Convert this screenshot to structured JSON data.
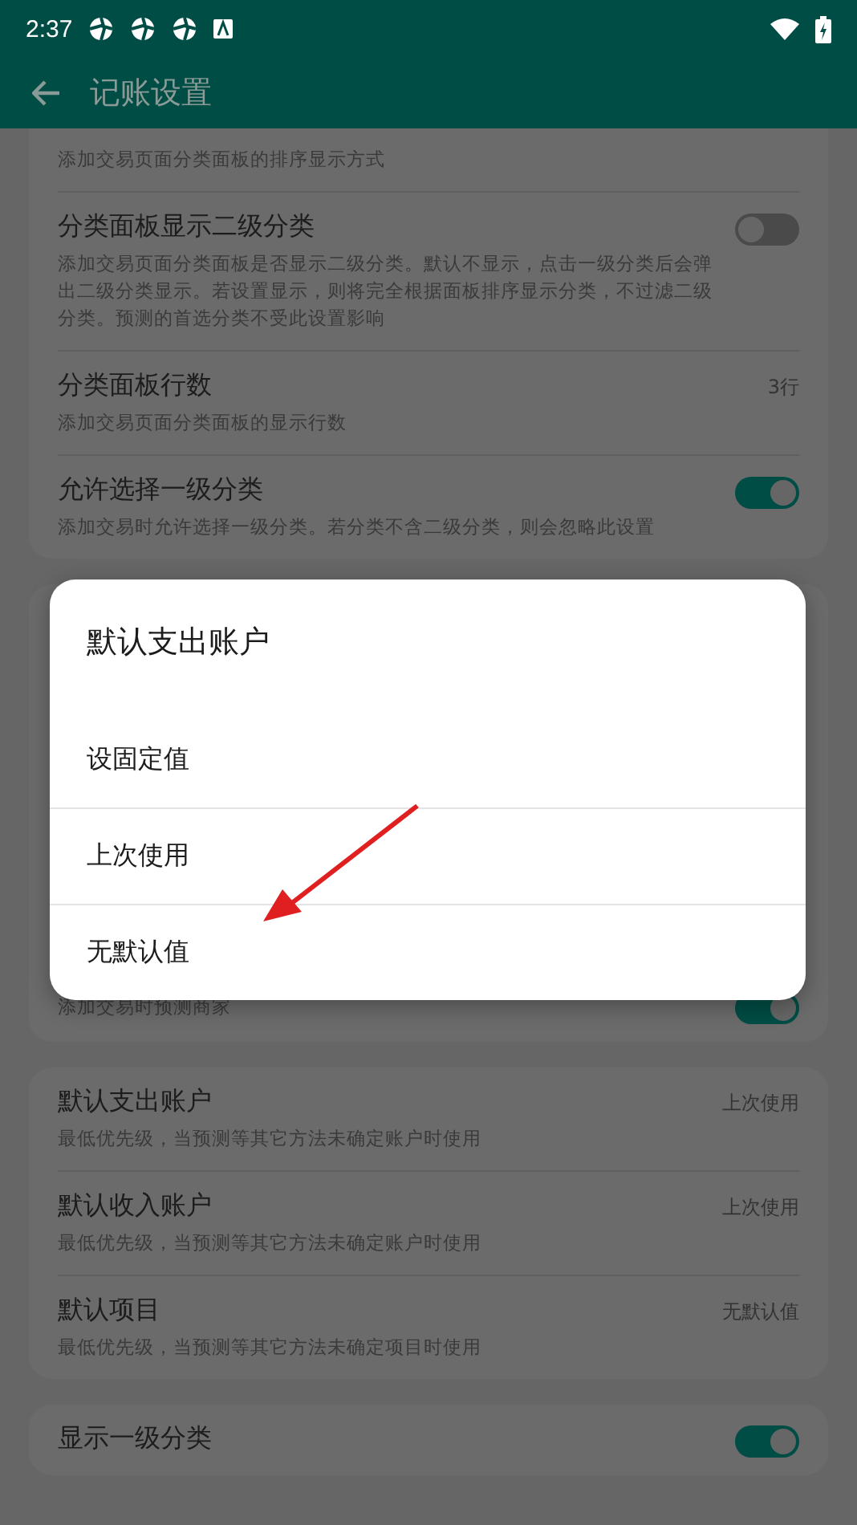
{
  "status_bar": {
    "time": "2:37"
  },
  "app_bar": {
    "title": "记账设置"
  },
  "cards": [
    {
      "rows": [
        {
          "kind": "note",
          "subtitle": "添加交易页面分类面板的排序显示方式"
        },
        {
          "kind": "toggle",
          "title": "分类面板显示二级分类",
          "subtitle": "添加交易页面分类面板是否显示二级分类。默认不显示，点击一级分类后会弹出二级分类显示。若设置显示，则将完全根据面板排序显示分类，不过滤二级分类。预测的首选分类不受此设置影响",
          "on": false
        },
        {
          "kind": "value",
          "title": "分类面板行数",
          "subtitle": "添加交易页面分类面板的显示行数",
          "value": "3行"
        },
        {
          "kind": "toggle",
          "title": "允许选择一级分类",
          "subtitle": "添加交易时允许选择一级分类。若分类不含二级分类，则会忽略此设置",
          "on": true
        }
      ]
    },
    {
      "rows": [
        {
          "kind": "toggle",
          "subtitle": "添加交易时预测商家",
          "on": true
        }
      ]
    },
    {
      "rows": [
        {
          "kind": "value",
          "title": "默认支出账户",
          "subtitle": "最低优先级，当预测等其它方法未确定账户时使用",
          "value": "上次使用"
        },
        {
          "kind": "value",
          "title": "默认收入账户",
          "subtitle": "最低优先级，当预测等其它方法未确定账户时使用",
          "value": "上次使用"
        },
        {
          "kind": "value",
          "title": "默认项目",
          "subtitle": "最低优先级，当预测等其它方法未确定项目时使用",
          "value": "无默认值"
        }
      ]
    },
    {
      "rows": [
        {
          "kind": "toggle",
          "title": "显示一级分类",
          "on": true
        }
      ]
    }
  ],
  "dialog": {
    "title": "默认支出账户",
    "options": [
      "设固定值",
      "上次使用",
      "无默认值"
    ]
  }
}
